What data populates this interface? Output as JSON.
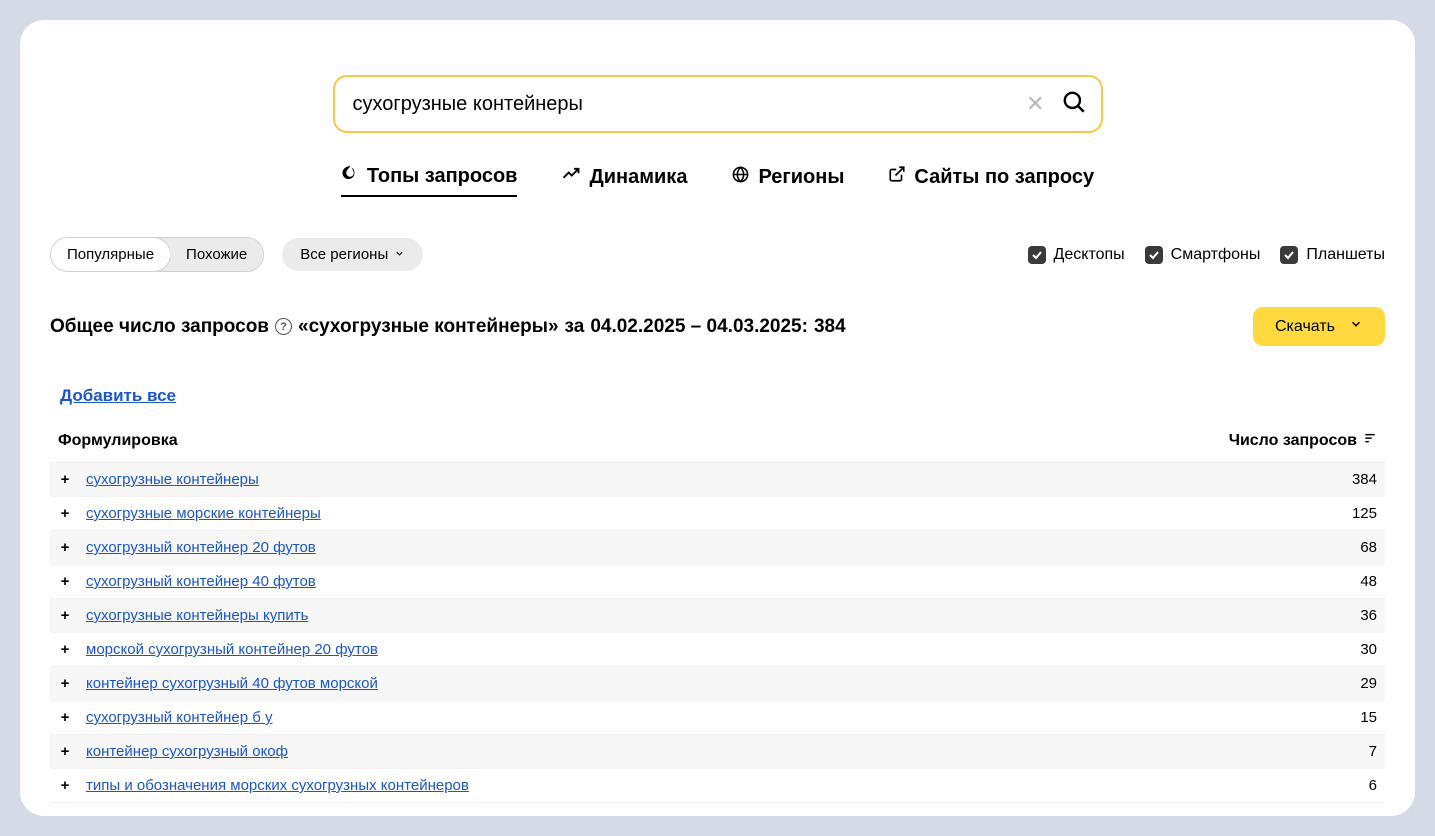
{
  "search": {
    "value": "сухогрузные контейнеры"
  },
  "tabs": [
    {
      "label": "Топы запросов",
      "icon": "fire",
      "active": true
    },
    {
      "label": "Динамика",
      "icon": "trend",
      "active": false
    },
    {
      "label": "Регионы",
      "icon": "globe",
      "active": false
    },
    {
      "label": "Сайты по запросу",
      "icon": "external",
      "active": false
    }
  ],
  "toggle": {
    "options": [
      "Популярные",
      "Похожие"
    ],
    "active_index": 0
  },
  "region_selector": {
    "label": "Все регионы"
  },
  "devices": [
    {
      "label": "Десктопы",
      "checked": true
    },
    {
      "label": "Смартфоны",
      "checked": true
    },
    {
      "label": "Планшеты",
      "checked": true
    }
  ],
  "summary": {
    "prefix": "Общее число запросов",
    "help": "?",
    "query": "«сухогрузные контейнеры»",
    "period_prefix": "за",
    "period": "04.02.2025 – 04.03.2025:",
    "total": "384"
  },
  "download_label": "Скачать",
  "add_all_label": "Добавить все",
  "columns": {
    "phrase": "Формулировка",
    "count": "Число запросов"
  },
  "rows": [
    {
      "phrase": "сухогрузные контейнеры",
      "count": 384
    },
    {
      "phrase": "сухогрузные морские контейнеры",
      "count": 125
    },
    {
      "phrase": "сухогрузный контейнер 20 футов",
      "count": 68
    },
    {
      "phrase": "сухогрузный контейнер 40 футов",
      "count": 48
    },
    {
      "phrase": "сухогрузные контейнеры купить",
      "count": 36
    },
    {
      "phrase": "морской сухогрузный контейнер 20 футов",
      "count": 30
    },
    {
      "phrase": "контейнер сухогрузный 40 футов морской",
      "count": 29
    },
    {
      "phrase": "сухогрузный контейнер б у",
      "count": 15
    },
    {
      "phrase": "контейнер сухогрузный окоф",
      "count": 7
    },
    {
      "phrase": "типы и обозначения морских сухогрузных контейнеров",
      "count": 6
    }
  ]
}
